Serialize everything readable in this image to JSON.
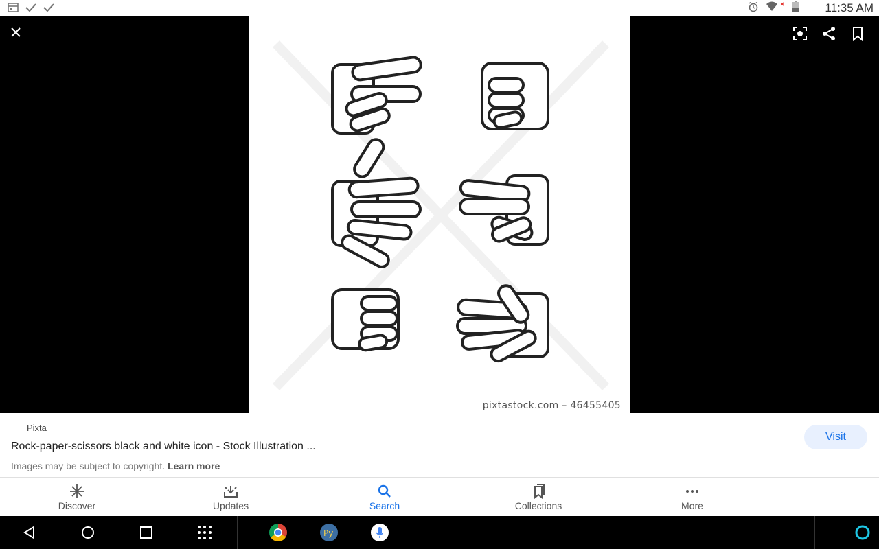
{
  "status_bar": {
    "time": "11:35 AM",
    "left_icons": [
      "calendar-icon",
      "check-icon",
      "check-icon"
    ],
    "right_icons": [
      "alarm-icon",
      "wifi-icon",
      "battery-icon"
    ]
  },
  "viewer": {
    "watermark": "pixtastock.com – 46455405"
  },
  "result": {
    "source": "Pixta",
    "title": "Rock-paper-scissors black and white icon - Stock Illustration ...",
    "copyright_notice": "Images may be subject to copyright.",
    "learn_more": "Learn more",
    "visit_label": "Visit"
  },
  "bottom_nav": {
    "discover": "Discover",
    "updates": "Updates",
    "search": "Search",
    "collections": "Collections",
    "more": "More"
  },
  "colors": {
    "accent": "#1a73e8",
    "visit_bg": "#e8f0fe",
    "viewer_bg": "#000000"
  }
}
